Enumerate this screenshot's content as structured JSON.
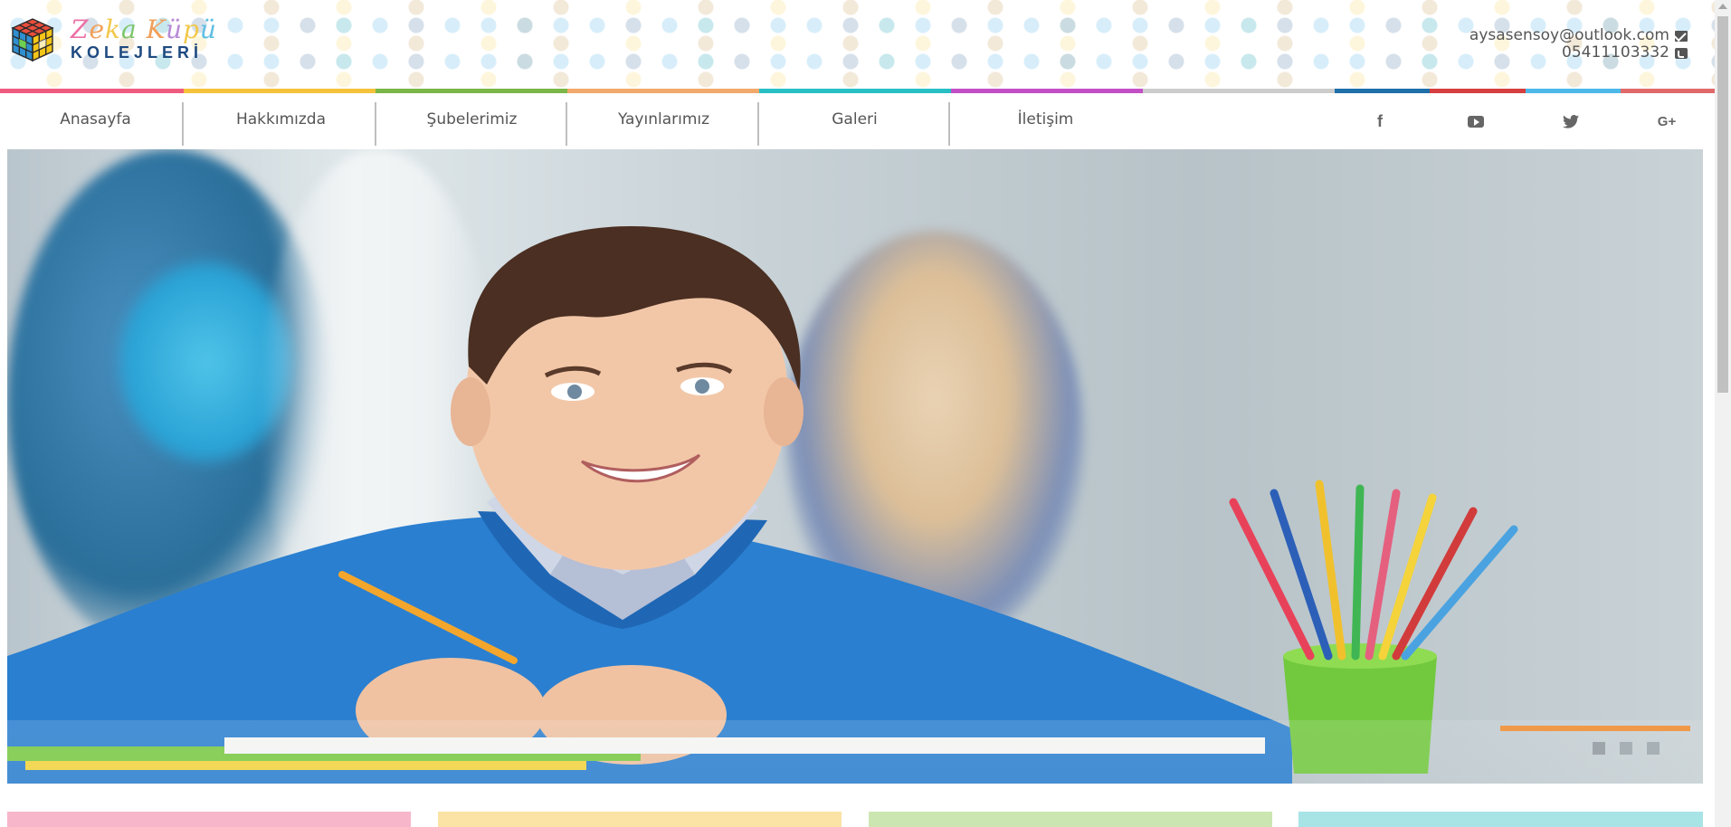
{
  "brand": {
    "script_text": [
      "Z",
      "e",
      "k",
      "a",
      " ",
      "K",
      "ü",
      "p",
      "ü"
    ],
    "sub_text": "KOLEJLERİ"
  },
  "contact": {
    "email": "aysasensoy@outlook.com",
    "phone": "05411103332",
    "email_icon": "envelope-icon",
    "phone_icon": "phone-square-icon"
  },
  "nav": {
    "items": [
      {
        "label": "Anasayfa"
      },
      {
        "label": "Hakkımızda"
      },
      {
        "label": "Şubelerimiz"
      },
      {
        "label": "Yayınlarımız"
      },
      {
        "label": "Galeri"
      },
      {
        "label": "İletişim"
      }
    ],
    "social": [
      {
        "name": "facebook",
        "glyph": "f"
      },
      {
        "name": "youtube",
        "glyph": ""
      },
      {
        "name": "twitter",
        "glyph": "🐦"
      },
      {
        "name": "google-plus",
        "glyph": "G+"
      }
    ]
  },
  "strip_colors": [
    "#ef5b7f",
    "#f5c23b",
    "#7ab648",
    "#f3a86b",
    "#29c0c5",
    "#c34fc6",
    "#cccccc",
    "#1f6fa8",
    "#d63f3f",
    "#4cb9e8",
    "#e06a6a"
  ],
  "slider": {
    "slides": 3,
    "active": 0
  },
  "cards": {
    "colors": [
      "#f7b6c9",
      "#fbe3a6",
      "#cce6b2",
      "#a8e3e6"
    ]
  }
}
